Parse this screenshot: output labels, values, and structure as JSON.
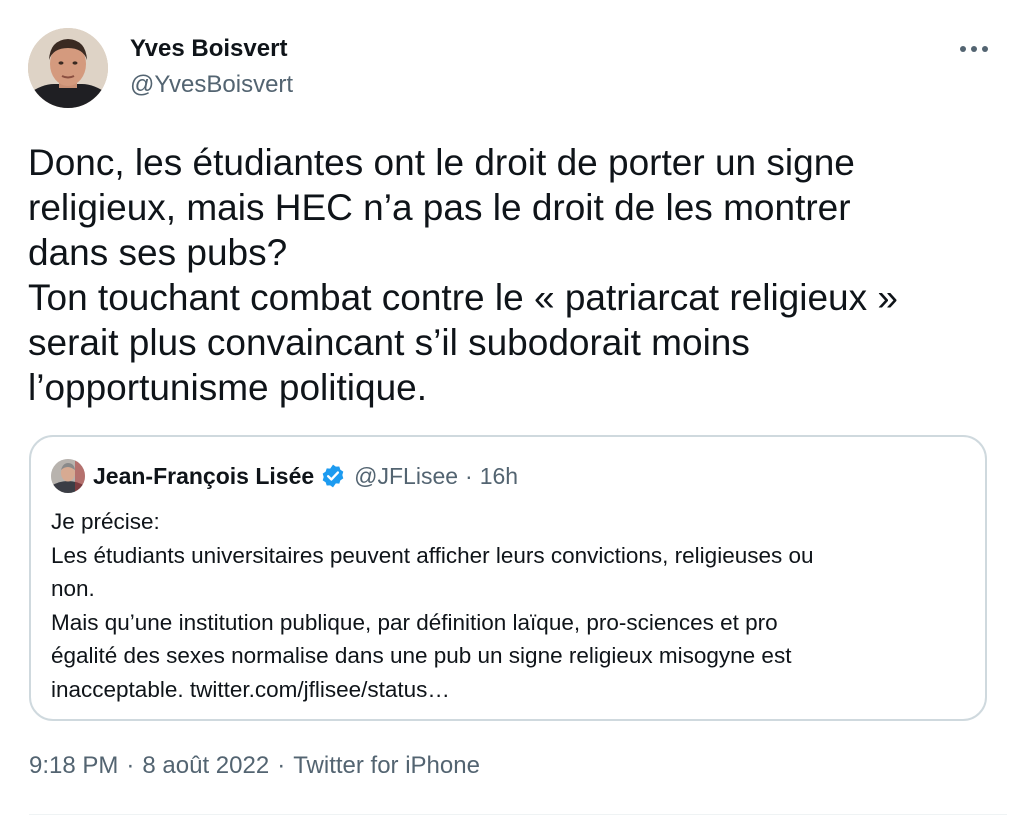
{
  "author": {
    "name": "Yves Boisvert",
    "handle": "@YvesBoisvert"
  },
  "more_icon": "more-horizontal-icon",
  "tweet": {
    "lines": [
      "Donc, les étudiantes ont le droit de porter un signe",
      "religieux, mais HEC n’a pas le droit de les montrer",
      "dans ses pubs?",
      "Ton touchant combat contre le « patriarcat religieux »",
      "serait plus convaincant s’il subodorait moins",
      "l’opportunisme politique."
    ]
  },
  "quote": {
    "name": "Jean-François Lisée",
    "verified_icon": "verified-badge-icon",
    "handle": "@JFLisee",
    "separator": "·",
    "time": "16h",
    "lines": [
      "Je précise:",
      "Les étudiants universitaires peuvent afficher leurs convictions, religieuses ou",
      "non.",
      "Mais qu’une institution publique, par définition laïque, pro-sciences et pro",
      "égalité des sexes normalise dans une pub un signe religieux misogyne est",
      "inacceptable. twitter.com/jflisee/status…"
    ]
  },
  "meta": {
    "time": "9:18 PM",
    "separator": "·",
    "date": "8 août 2022",
    "source": "Twitter for iPhone"
  },
  "colors": {
    "text": "#0f1419",
    "secondary": "#536471",
    "border": "#cfd9de",
    "verified": "#1d9bf0"
  }
}
